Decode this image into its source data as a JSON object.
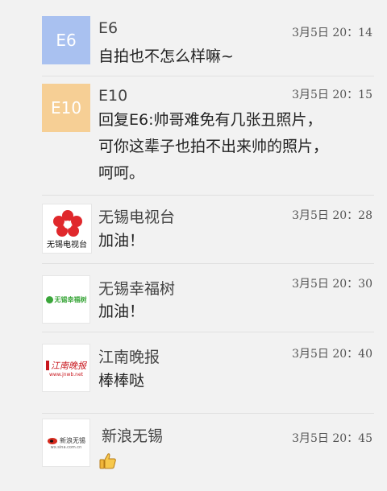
{
  "colors": {
    "e6_avatar": "#a9c1f0",
    "e10_avatar": "#f6cf95",
    "background": "#f2f2f2",
    "divider": "#e0e0e0"
  },
  "comments": [
    {
      "avatar_text": "E6",
      "author": "E6",
      "time": "3月5日  20：14",
      "text": "自拍也不怎么样嘛~"
    },
    {
      "avatar_text": "E10",
      "author": "E10",
      "time": "3月5日  20：15",
      "text": "回复E6:帅哥难免有几张丑照片，\n可你这辈子也拍不出来帅的照片，\n呵呵。"
    },
    {
      "avatar_icon": "flower-logo-icon",
      "avatar_caption": "无锡电视台",
      "author": "无锡电视台",
      "time": "3月5日  20：28",
      "text": "加油！"
    },
    {
      "avatar_icon": "leaf-logo-icon",
      "avatar_label": "无锡幸福树",
      "author": "无锡幸福树",
      "time": "3月5日  20：30",
      "text": "加油！"
    },
    {
      "avatar_icon": "newspaper-logo-icon",
      "avatar_label": "江南晚报",
      "avatar_sublabel": "www.jnwb.net",
      "author": "江南晚报",
      "time": "3月5日  20：40",
      "text": "棒棒哒"
    },
    {
      "avatar_icon": "sina-logo-icon",
      "avatar_label": "新浪无锡",
      "avatar_sublabel": "wx.sina.com.cn",
      "author": "新浪无锡",
      "time": "3月5日  20：45",
      "text": "",
      "emoji": "thumbs-up-icon"
    }
  ]
}
